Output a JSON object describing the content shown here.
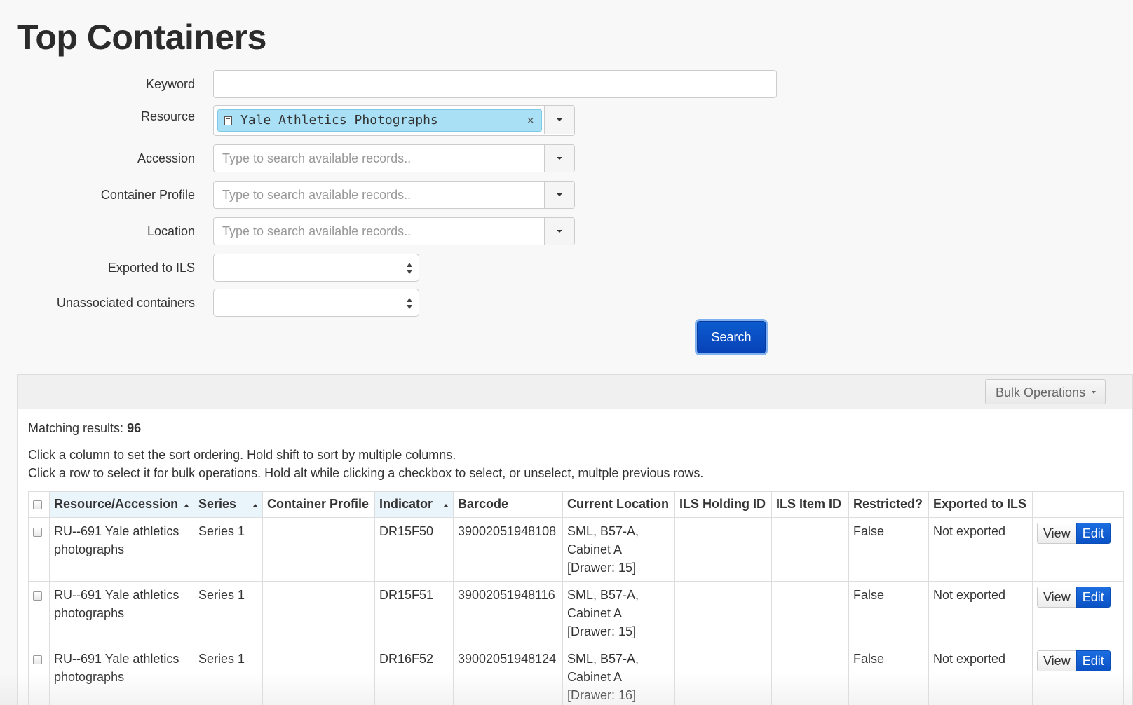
{
  "page_title": "Top Containers",
  "form": {
    "keyword": {
      "label": "Keyword",
      "value": ""
    },
    "resource": {
      "label": "Resource",
      "token": "Yale Athletics Photographs",
      "remove": "×"
    },
    "accession": {
      "label": "Accession",
      "placeholder": "Type to search available records.."
    },
    "container_profile": {
      "label": "Container Profile",
      "placeholder": "Type to search available records.."
    },
    "location": {
      "label": "Location",
      "placeholder": "Type to search available records.."
    },
    "exported_to_ils": {
      "label": "Exported to ILS",
      "value": ""
    },
    "unassociated": {
      "label": "Unassociated containers",
      "value": ""
    },
    "search_label": "Search"
  },
  "results": {
    "bulk_label": "Bulk Operations",
    "matching_label": "Matching results:",
    "matching_count": "96",
    "help_sort": "Click a column to set the sort ordering. Hold shift to sort by multiple columns.",
    "help_select": "Click a row to select it for bulk operations. Hold alt while clicking a checkbox to select, or unselect, multple previous rows.",
    "columns": [
      "Resource/Accession",
      "Series",
      "Container Profile",
      "Indicator",
      "Barcode",
      "Current Location",
      "ILS Holding ID",
      "ILS Item ID",
      "Restricted?",
      "Exported to ILS"
    ],
    "view_label": "View",
    "edit_label": "Edit",
    "rows": [
      {
        "resource": "RU--691 Yale athletics photographs",
        "series": "Series 1",
        "profile": "",
        "indicator": "DR15F50",
        "barcode": "39002051948108",
        "location": "SML, B57-A, Cabinet A [Drawer: 15]",
        "holding": "",
        "item": "",
        "restricted": "False",
        "exported": "Not exported"
      },
      {
        "resource": "RU--691 Yale athletics photographs",
        "series": "Series 1",
        "profile": "",
        "indicator": "DR15F51",
        "barcode": "39002051948116",
        "location": "SML, B57-A, Cabinet A [Drawer: 15]",
        "holding": "",
        "item": "",
        "restricted": "False",
        "exported": "Not exported"
      },
      {
        "resource": "RU--691 Yale athletics photographs",
        "series": "Series 1",
        "profile": "",
        "indicator": "DR16F52",
        "barcode": "39002051948124",
        "location": "SML, B57-A, Cabinet A [Drawer: 16]",
        "holding": "",
        "item": "",
        "restricted": "False",
        "exported": "Not exported"
      }
    ]
  }
}
